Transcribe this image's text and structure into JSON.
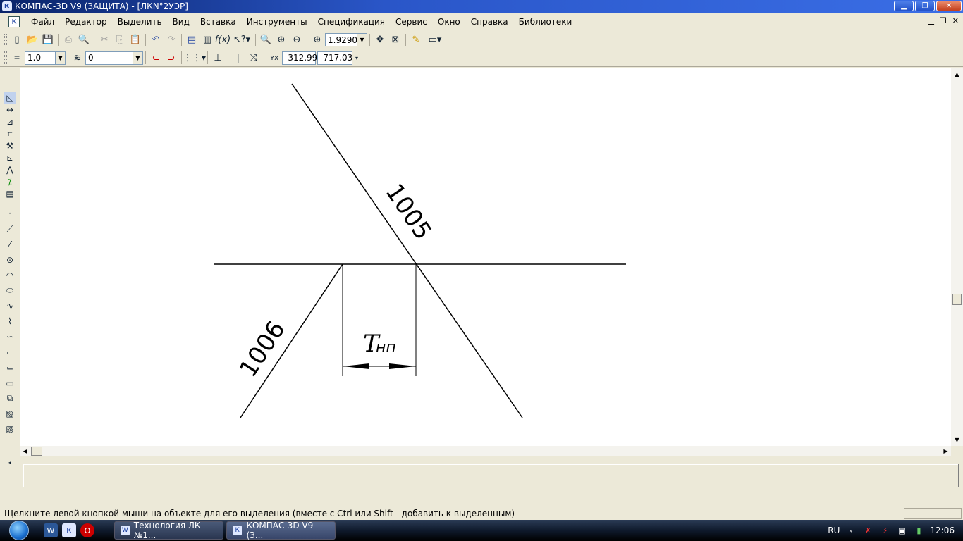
{
  "window": {
    "title": "КОМПАС-3D V9 (ЗАЩИТА) - [ЛКN°2УЭР]",
    "app_icon": "К"
  },
  "menu": [
    {
      "label": "Файл"
    },
    {
      "label": "Редактор"
    },
    {
      "label": "Выделить"
    },
    {
      "label": "Вид"
    },
    {
      "label": "Вставка"
    },
    {
      "label": "Инструменты"
    },
    {
      "label": "Спецификация"
    },
    {
      "label": "Сервис"
    },
    {
      "label": "Окно"
    },
    {
      "label": "Справка"
    },
    {
      "label": "Библиотеки"
    }
  ],
  "toolbar": {
    "zoom_value": "1.9290"
  },
  "toolbar2": {
    "step_value": "1.0",
    "layer_value": "0",
    "coord_x": "-312.99",
    "coord_y": "-717.03"
  },
  "drawing": {
    "label_upper": "1005",
    "label_lower": "1006",
    "dim_label_main": "T",
    "dim_label_sub": "нп"
  },
  "status": {
    "message": "Щелкните левой кнопкой мыши на объекте для его выделения (вместе с Ctrl или Shift - добавить к выделенным)"
  },
  "taskbar": {
    "tasks": [
      {
        "label": "Технология ЛК №1...",
        "icon": "word-icon"
      },
      {
        "label": "КОМПАС-3D V9 (З...",
        "icon": "kompas-icon"
      }
    ],
    "lang": "RU",
    "clock": "12:06"
  }
}
